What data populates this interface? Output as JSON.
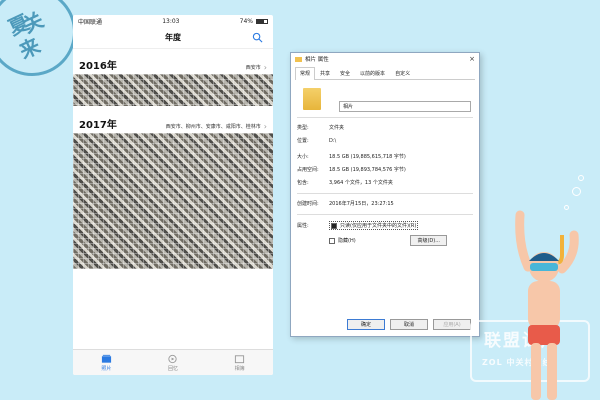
{
  "stamp": {
    "chars": [
      "夏",
      "关",
      "来"
    ]
  },
  "phone": {
    "status": {
      "carrier": "中国联通",
      "time": "13:03",
      "battery": "74%"
    },
    "nav_title": "年度",
    "sections": [
      {
        "year": "2016年",
        "locations": "西安市"
      },
      {
        "year": "2017年",
        "locations": "西安市、柳州市、安康市、咸阳市、桂林市"
      }
    ],
    "tabs": [
      {
        "label": "照片",
        "active": true
      },
      {
        "label": "回忆",
        "active": false
      },
      {
        "label": "相簿",
        "active": false
      }
    ]
  },
  "dialog": {
    "title": "相片 属性",
    "tabs": [
      "常规",
      "共享",
      "安全",
      "以前的版本",
      "自定义"
    ],
    "name": "相片",
    "fields": [
      {
        "label": "类型:",
        "value": "文件夹"
      },
      {
        "label": "位置:",
        "value": "D:\\"
      },
      {
        "label": "大小:",
        "value": "18.5 GB (19,885,615,718 字节)"
      },
      {
        "label": "占用空间:",
        "value": "18.5 GB (19,893,784,576 字节)"
      },
      {
        "label": "包含:",
        "value": "3,964 个文件，13 个文件夹"
      },
      {
        "label": "创建时间:",
        "value": "2016年7月15日，23:27:15"
      }
    ],
    "attributes_label": "属性:",
    "readonly_label": "只读(仅应用于文件夹中的文件)(R)",
    "hidden_label": "隐藏(H)",
    "advanced_label": "高级(D)...",
    "buttons": {
      "ok": "确定",
      "cancel": "取消",
      "apply": "应用(A)"
    }
  },
  "watermark": {
    "line1": "联盟试用",
    "line2": "ZOL 中关村在线"
  }
}
